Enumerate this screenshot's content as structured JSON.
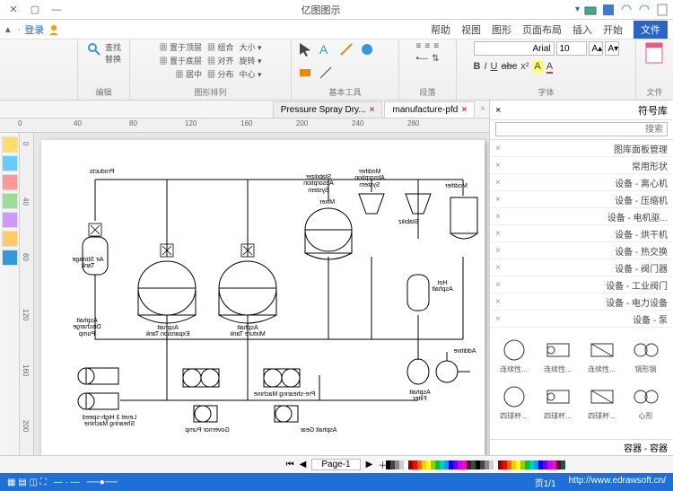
{
  "titlebar": {
    "title": "亿图图示"
  },
  "menubar": {
    "login": "登录",
    "items": [
      "文件",
      "开始",
      "插入",
      "页面布局",
      "图形",
      "视图",
      "帮助"
    ]
  },
  "ribbon": {
    "groups": {
      "file": "文件",
      "font": "字体",
      "para": "段落",
      "tools": "基本工具",
      "arrange": "图形排列",
      "edit": "编辑"
    },
    "font": {
      "name": "Arial",
      "size": "10"
    }
  },
  "tabs": [
    {
      "label": "manufacture-pfd",
      "active": true
    },
    {
      "label": "Pressure Spray Dry...",
      "active": false
    }
  ],
  "sidepanel": {
    "title": "符号库",
    "placeholder": "搜索",
    "footer": "容器 - 容器",
    "categories": [
      "图库面板管理",
      "常用形状",
      "设备 - 离心机",
      "设备 - 压缩机",
      "设备 - 电机驱...",
      "设备 - 烘干机",
      "设备 - 热交换",
      "设备 - 阀门器",
      "设备 - 工业阀门",
      "设备 - 电力设备",
      "设备 - 泵"
    ],
    "shapes_row1": [
      "连续性...",
      "连续性...",
      "连续性...",
      "锅形锅"
    ],
    "shapes_row2": [
      "四球杯...",
      "四球杯...",
      "四球杯...",
      "心形"
    ]
  },
  "diagram": {
    "labels": {
      "products": "Products",
      "modifier": "Modifier",
      "modifier_sys": "Modifier Absorption System",
      "stabilizer_sys": "Stabilizer Absorption System",
      "stabiliz": "Stabiliz",
      "mixer": "Mixer",
      "air_storage": "Air Storage Tank",
      "hot_asphalt": "Hot Asphalt",
      "asphalt_discharge": "Asphalt Discharge Pump",
      "asphalt_expansion": "Asphalt Expansion Tank",
      "asphalt_mixture": "Asphalt Mixture Tank",
      "asphalt_filter": "Asphalt Filter",
      "additive": "Additive",
      "level3": "Level 3 High-speed Shearing Machine",
      "preshearing": "Pre-shearing Machine",
      "governor": "Governor Pump",
      "asphalt_gear": "Asphalt Gear"
    }
  },
  "pagebar": {
    "page": "Page-1"
  },
  "status": {
    "left": "页1/1",
    "right": "http://www.edrawsoft.cn/"
  },
  "ruler_h": [
    "0",
    "40",
    "80",
    "120",
    "160",
    "200",
    "240",
    "280"
  ],
  "ruler_v": [
    "0",
    "40",
    "80",
    "120",
    "160",
    "200"
  ]
}
